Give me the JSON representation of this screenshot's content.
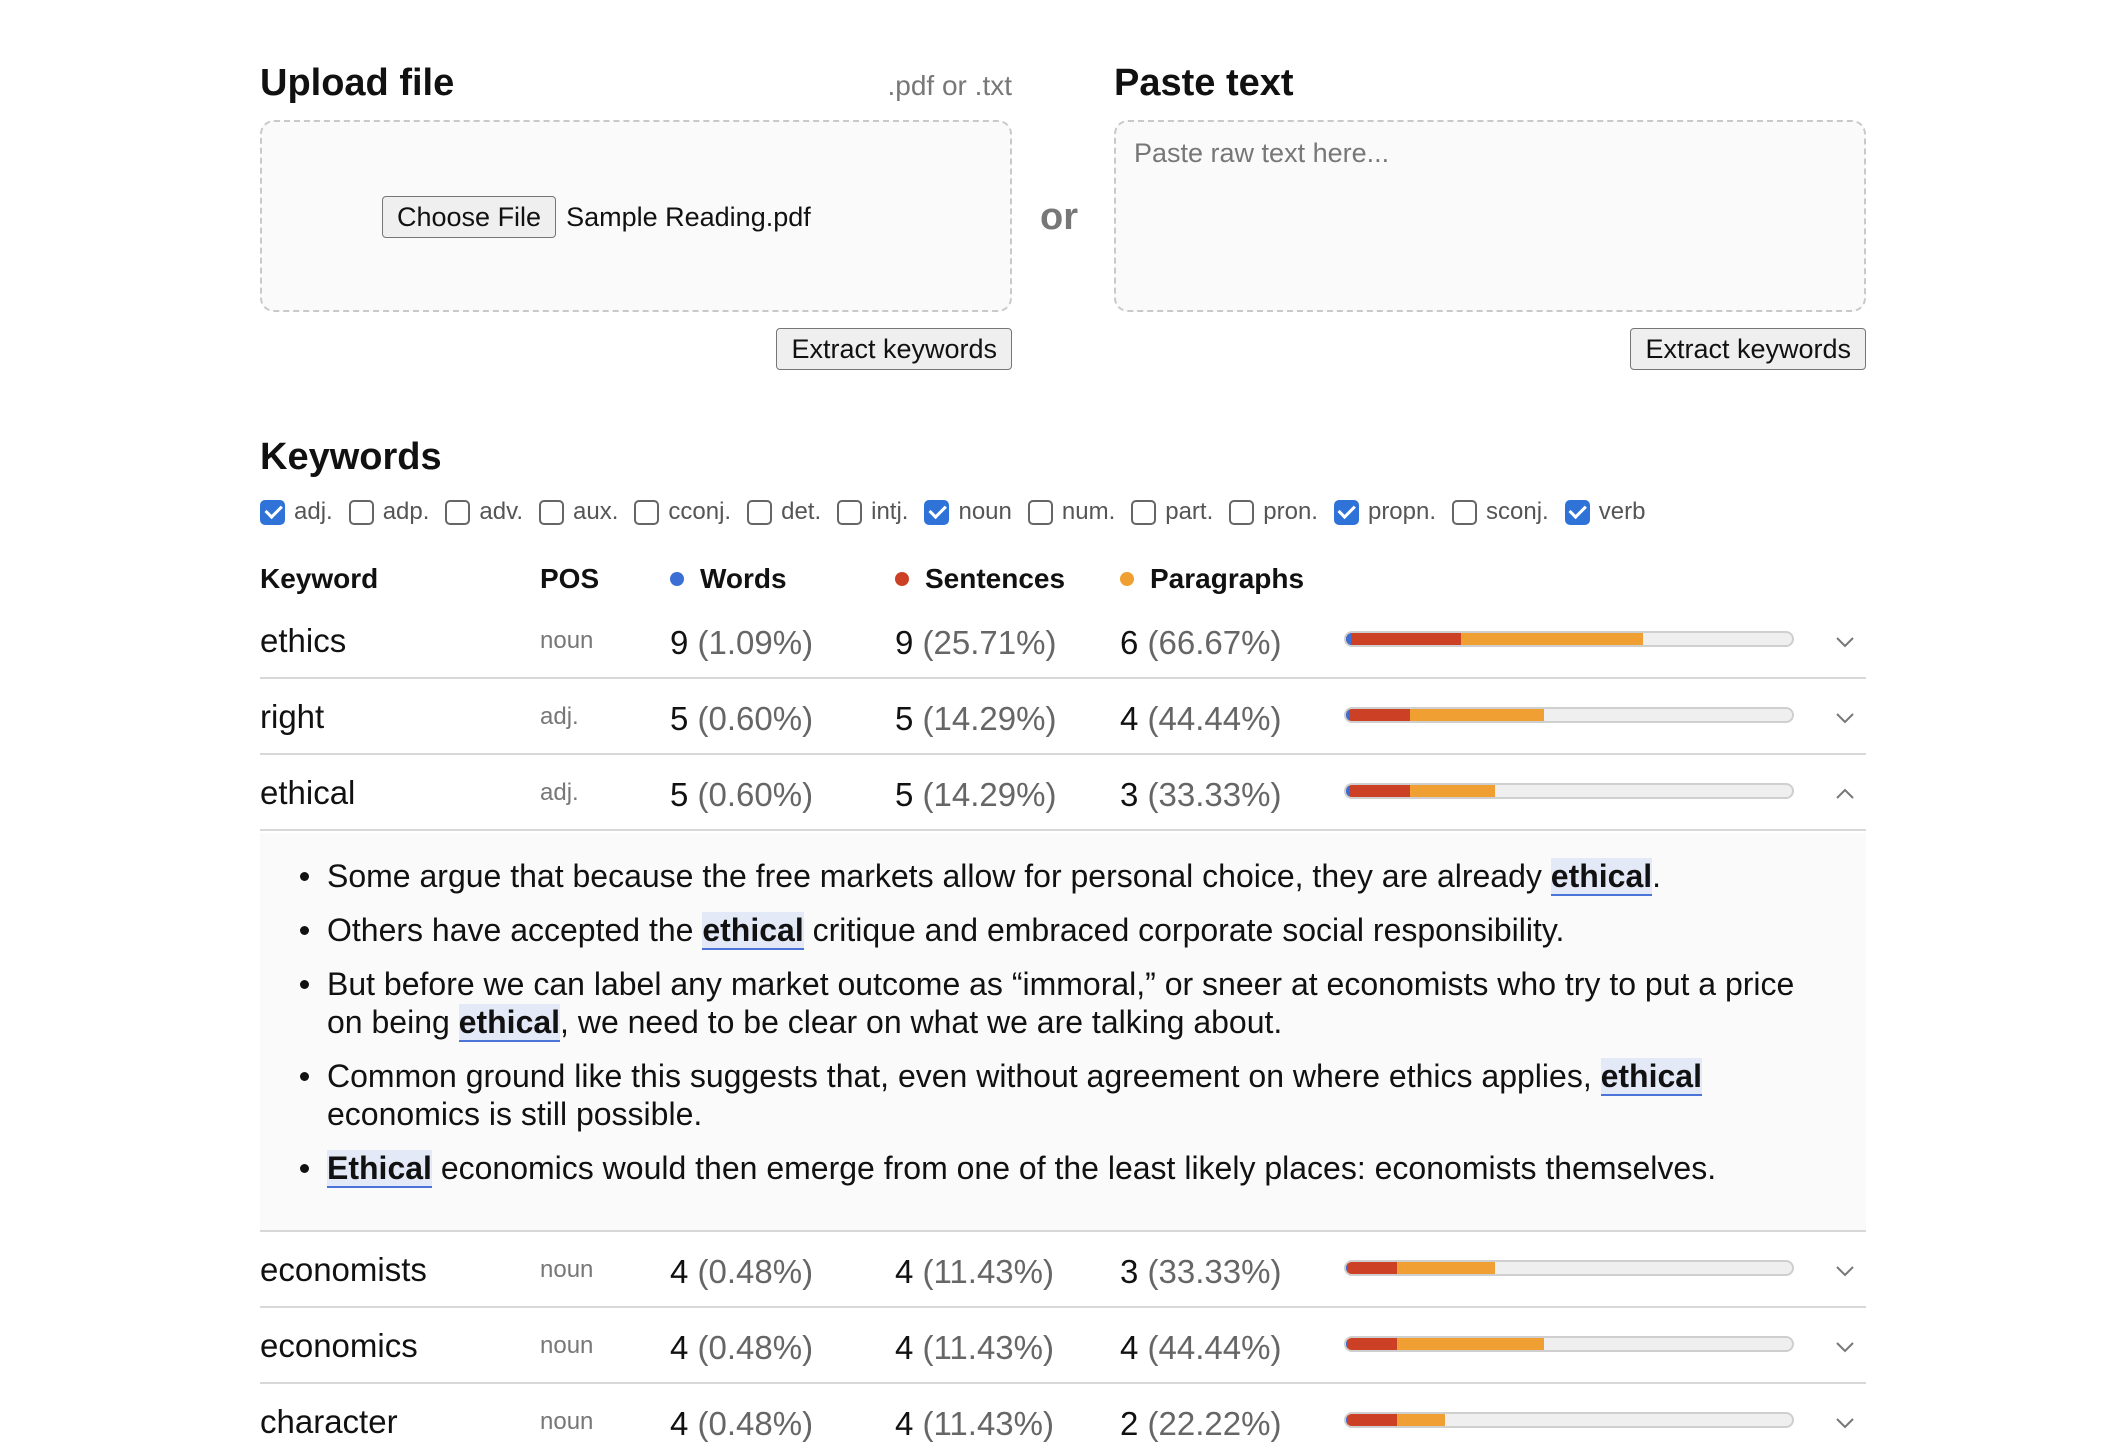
{
  "upload": {
    "title": "Upload file",
    "hint": ".pdf or .txt",
    "choose_label": "Choose File",
    "file_name": "Sample Reading.pdf",
    "extract_label": "Extract keywords"
  },
  "divider": {
    "or_label": "or"
  },
  "paste": {
    "title": "Paste text",
    "placeholder": "Paste raw text here...",
    "extract_label": "Extract keywords"
  },
  "keywords": {
    "title": "Keywords",
    "pos_filters": [
      {
        "label": "adj.",
        "checked": true
      },
      {
        "label": "adp.",
        "checked": false
      },
      {
        "label": "adv.",
        "checked": false
      },
      {
        "label": "aux.",
        "checked": false
      },
      {
        "label": "cconj.",
        "checked": false
      },
      {
        "label": "det.",
        "checked": false
      },
      {
        "label": "intj.",
        "checked": false
      },
      {
        "label": "noun",
        "checked": true
      },
      {
        "label": "num.",
        "checked": false
      },
      {
        "label": "part.",
        "checked": false
      },
      {
        "label": "pron.",
        "checked": false
      },
      {
        "label": "propn.",
        "checked": true
      },
      {
        "label": "sconj.",
        "checked": false
      },
      {
        "label": "verb",
        "checked": true
      }
    ],
    "columns": {
      "keyword": "Keyword",
      "pos": "POS",
      "words": "Words",
      "sentences": "Sentences",
      "paragraphs": "Paragraphs"
    },
    "colors": {
      "words": "#3b6fd6",
      "sentences": "#cc4125",
      "paragraphs": "#f0a033"
    },
    "rows": [
      {
        "keyword": "ethics",
        "pos": "noun",
        "words": "9",
        "words_pct": "(1.09%)",
        "sentences": "9",
        "sentences_pct": "(25.71%)",
        "paragraphs": "6",
        "paragraphs_pct": "(66.67%)",
        "w_frac": 0.0109,
        "s_frac": 0.2571,
        "p_frac": 0.6667,
        "expanded": false
      },
      {
        "keyword": "right",
        "pos": "adj.",
        "words": "5",
        "words_pct": "(0.60%)",
        "sentences": "5",
        "sentences_pct": "(14.29%)",
        "paragraphs": "4",
        "paragraphs_pct": "(44.44%)",
        "w_frac": 0.006,
        "s_frac": 0.1429,
        "p_frac": 0.4444,
        "expanded": false
      },
      {
        "keyword": "ethical",
        "pos": "adj.",
        "words": "5",
        "words_pct": "(0.60%)",
        "sentences": "5",
        "sentences_pct": "(14.29%)",
        "paragraphs": "3",
        "paragraphs_pct": "(33.33%)",
        "w_frac": 0.006,
        "s_frac": 0.1429,
        "p_frac": 0.3333,
        "expanded": true
      },
      {
        "keyword": "economists",
        "pos": "noun",
        "words": "4",
        "words_pct": "(0.48%)",
        "sentences": "4",
        "sentences_pct": "(11.43%)",
        "paragraphs": "3",
        "paragraphs_pct": "(33.33%)",
        "w_frac": 0.0048,
        "s_frac": 0.1143,
        "p_frac": 0.3333,
        "expanded": false
      },
      {
        "keyword": "economics",
        "pos": "noun",
        "words": "4",
        "words_pct": "(0.48%)",
        "sentences": "4",
        "sentences_pct": "(11.43%)",
        "paragraphs": "4",
        "paragraphs_pct": "(44.44%)",
        "w_frac": 0.0048,
        "s_frac": 0.1143,
        "p_frac": 0.4444,
        "expanded": false
      },
      {
        "keyword": "character",
        "pos": "noun",
        "words": "4",
        "words_pct": "(0.48%)",
        "sentences": "4",
        "sentences_pct": "(11.43%)",
        "paragraphs": "2",
        "paragraphs_pct": "(22.22%)",
        "w_frac": 0.0048,
        "s_frac": 0.1143,
        "p_frac": 0.2222,
        "expanded": false
      }
    ],
    "sentences_list": [
      [
        {
          "t": "Some argue that because the free markets allow for personal choice, they are already "
        },
        {
          "t": "ethical",
          "hl": true
        },
        {
          "t": "."
        }
      ],
      [
        {
          "t": "Others have accepted the "
        },
        {
          "t": "ethical",
          "hl": true
        },
        {
          "t": " critique and embraced corporate social responsibility."
        }
      ],
      [
        {
          "t": "But before we can label any market outcome as “immoral,” or sneer at economists who try to put a price on being "
        },
        {
          "t": "ethical",
          "hl": true
        },
        {
          "t": ", we need to be clear on what we are talking about."
        }
      ],
      [
        {
          "t": "Common ground like this suggests that, even without agreement on where ethics applies, "
        },
        {
          "t": "ethical",
          "hl": true
        },
        {
          "t": " economics is still possible."
        }
      ],
      [
        {
          "t": "Ethical",
          "hl": true
        },
        {
          "t": " economics would then emerge from one of the least likely places: economists themselves."
        }
      ]
    ]
  }
}
